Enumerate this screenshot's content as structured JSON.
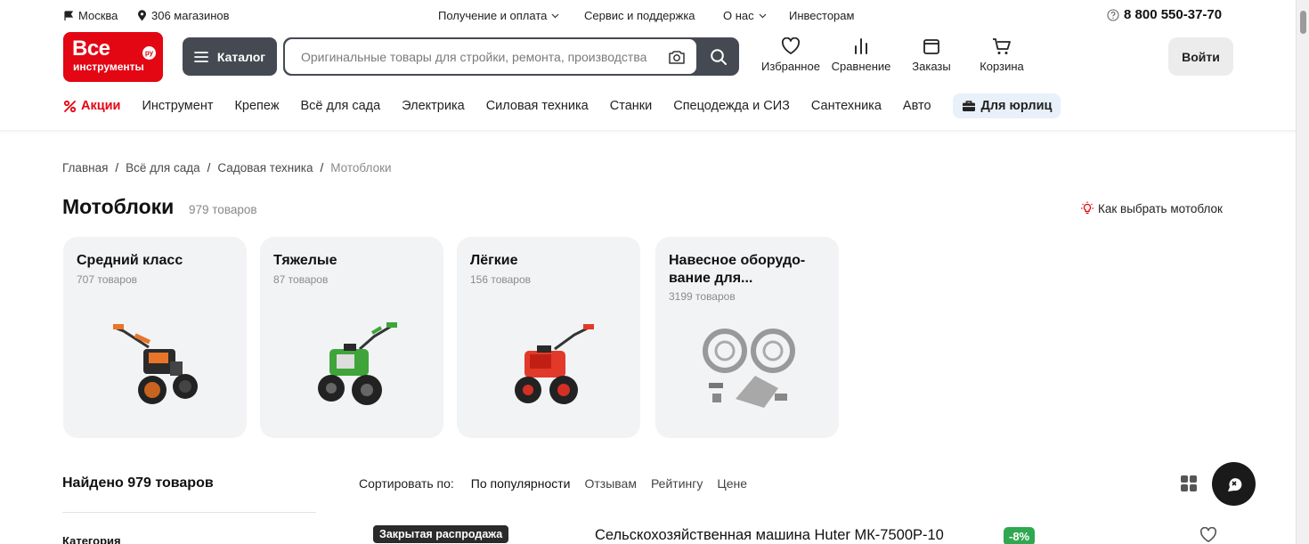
{
  "topbar": {
    "city": "Москва",
    "stores": "306 магазинов",
    "links": [
      "Получение и оплата",
      "Сервис и поддержка",
      "О нас",
      "Инвесторам"
    ],
    "phone": "8 800 550-37-70"
  },
  "logo": {
    "line1": "Все",
    "line2": "инструменты",
    "badge": "ру"
  },
  "header": {
    "catalog_label": "Каталог",
    "search_placeholder": "Оригинальные товары для стройки, ремонта, производства",
    "favorites": "Избранное",
    "compare": "Сравнение",
    "orders": "Заказы",
    "cart": "Корзина",
    "login": "Войти"
  },
  "nav": {
    "promo": "Акции",
    "items": [
      "Инструмент",
      "Крепеж",
      "Всё для сада",
      "Электрика",
      "Силовая техника",
      "Станки",
      "Спецодежда и СИЗ",
      "Сантехника",
      "Авто"
    ],
    "b2b": "Для юрлиц"
  },
  "breadcrumbs": [
    "Главная",
    "Всё для сада",
    "Садовая техника",
    "Мотоблоки"
  ],
  "page": {
    "title": "Мотоблоки",
    "count": "979 товаров",
    "howto": "Как выбрать мотоблок"
  },
  "categories": [
    {
      "title": "Средний класс",
      "count": "707 товаров"
    },
    {
      "title": "Тяжелые",
      "count": "87 товаров"
    },
    {
      "title": "Лёгкие",
      "count": "156 товаров"
    },
    {
      "title": "Навесное оборудо-вание для...",
      "count": "3199 товаров"
    }
  ],
  "listing": {
    "found": "Найдено 979 товаров",
    "filter_heading": "Категория",
    "sort_label": "Сортировать по:",
    "sort_options": [
      "По популярности",
      "Отзывам",
      "Рейтингу",
      "Цене"
    ],
    "first_product": {
      "badge": "Закрытая распродажа",
      "title": "Сельскохозяйственная машина Huter МК-7500Р-10",
      "discount": "-8%"
    }
  },
  "colors": {
    "brand": "#e30613",
    "dark": "#454a52",
    "discount": "#2fa84f"
  }
}
